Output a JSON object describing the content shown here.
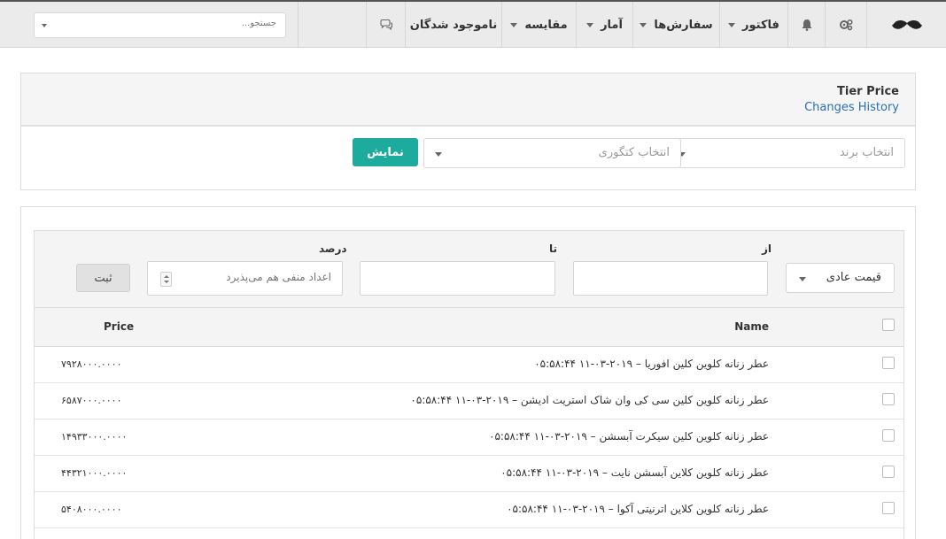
{
  "navbar": {
    "logo_icon": "mustache-logo-icon",
    "settings_icon": "gears-icon",
    "notifications_icon": "bell-icon",
    "factor_label": "فاکتور",
    "orders_label": "سفارش‌ها",
    "stats_label": "آمار",
    "compare_label": "مقایسه",
    "missing_label": "ناموجود شدگان",
    "chat_icon": "chat-icon",
    "search_placeholder": "جستجو..."
  },
  "tier_panel": {
    "title": "Tier Price",
    "history_link": "Changes History",
    "brand_placeholder": "انتخاب برند",
    "category_placeholder": "انتخاب کتگوری",
    "show_button": "نمایش",
    "accent_color": "#1cab9d"
  },
  "price_form": {
    "from_label": "از",
    "to_label": "تا",
    "percent_label": "درصد",
    "price_type_value": "قیمت عادی",
    "from_value": "",
    "to_value": "",
    "percent_placeholder": "اعداد منفی هم می‌پذیرد",
    "save_button": "ثبت"
  },
  "table": {
    "columns": {
      "name": "Name",
      "price": "Price"
    },
    "rows": [
      {
        "name": "عطر زنانه کلوین کلین افوریا – ۲۰۱۹-۰۳-۱۱ ۰۵:۵۸:۴۴",
        "price": "۷۹۲۸۰۰۰.۰۰۰۰"
      },
      {
        "name": "عطر زنانه کلوین کلین سی کی وان شاک استریت ادیشن – ۲۰۱۹-۰۳-۱۱ ۰۵:۵۸:۴۴",
        "price": "۶۵۸۷۰۰۰.۰۰۰۰"
      },
      {
        "name": "عطر زنانه کلوین کلین سیکرت آبسشن – ۲۰۱۹-۰۳-۱۱ ۰۵:۵۸:۴۴",
        "price": "۱۴۹۳۳۰۰۰.۰۰۰۰"
      },
      {
        "name": "عطر زنانه کلوین کلاین آبسشن نایت – ۲۰۱۹-۰۳-۱۱ ۰۵:۵۸:۴۴",
        "price": "۴۴۳۲۱۰۰۰.۰۰۰۰"
      },
      {
        "name": "عطر زنانه کلوین کلاین اترنیتی آکوا – ۲۰۱۹-۰۳-۱۱ ۰۵:۵۸:۴۴",
        "price": "۵۴۰۸۰۰۰.۰۰۰۰"
      }
    ]
  }
}
